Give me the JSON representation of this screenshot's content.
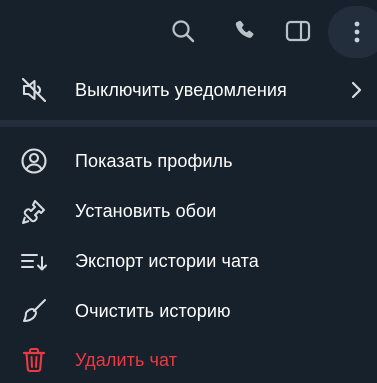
{
  "toolbar": {
    "icons": [
      "search-icon",
      "phone-icon",
      "sidebar-panel-icon",
      "more-vertical-icon"
    ],
    "icon_color": "#b9c1c9",
    "active_bg": "#232e3c"
  },
  "menu": {
    "mute": {
      "label": "Выключить уведомления",
      "icon": "bell-muted-icon",
      "has_submenu": true
    },
    "items": [
      {
        "label": "Показать профиль",
        "icon": "profile-icon"
      },
      {
        "label": "Установить обои",
        "icon": "brush-icon"
      },
      {
        "label": "Экспорт истории чата",
        "icon": "export-icon"
      },
      {
        "label": "Очистить историю",
        "icon": "broom-icon"
      },
      {
        "label": "Удалить чат",
        "icon": "trash-icon",
        "danger": true
      }
    ]
  },
  "colors": {
    "background": "#17212b",
    "separator": "#232e3c",
    "text": "#ffffff",
    "danger": "#ec3942",
    "icon": "#d6dce1"
  }
}
